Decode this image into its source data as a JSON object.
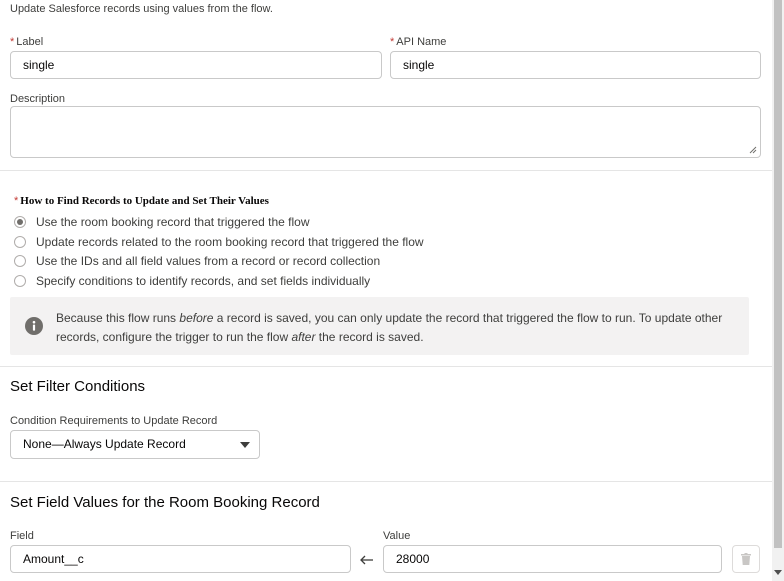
{
  "intro_text": "Update Salesforce records using values from the flow.",
  "label": {
    "asterisk": "*",
    "text": "Label",
    "value": "single"
  },
  "api_name": {
    "asterisk": "*",
    "text": "API Name",
    "value": "single"
  },
  "description": {
    "text": "Description",
    "value": ""
  },
  "find_records": {
    "asterisk": "*",
    "heading": "How to Find Records to Update and Set Their Values",
    "options": [
      {
        "label": "Use the room booking record that triggered the flow",
        "selected": true
      },
      {
        "label": "Update records related to the room booking record that triggered the flow",
        "selected": false
      },
      {
        "label": "Use the IDs and all field values from a record or record collection",
        "selected": false
      },
      {
        "label": "Specify conditions to identify records, and set fields individually",
        "selected": false
      }
    ]
  },
  "info_box": {
    "icon": "info-icon",
    "text_1": "Because this flow runs ",
    "text_before": "before",
    "text_2": " a record is saved, you can only update the record that triggered the flow to run. To update other",
    "text_3": "records, configure the trigger to run the flow ",
    "text_after": "after",
    "text_4": " the record is saved."
  },
  "filter": {
    "title": "Set Filter Conditions",
    "condition_label": "Condition Requirements to Update Record",
    "condition_value": "None—Always Update Record"
  },
  "field_values": {
    "title": "Set Field Values for the Room Booking Record",
    "field_label": "Field",
    "value_label": "Value",
    "rows": [
      {
        "field": "Amount__c",
        "value": "28000"
      }
    ]
  },
  "colors": {
    "required": "#c23934",
    "info_bg": "#f3f2f2",
    "border": "#c9c9c9"
  }
}
